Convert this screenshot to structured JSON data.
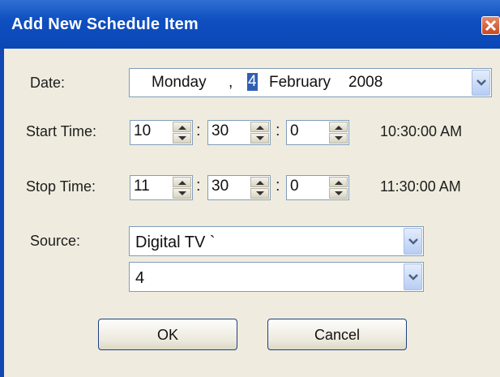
{
  "window": {
    "title": "Add New Schedule Item",
    "close_icon": "close-icon"
  },
  "date": {
    "label": "Date:",
    "day_name": "Monday",
    "separator": ",",
    "day": "4",
    "month": "February",
    "year": "2008"
  },
  "start_time": {
    "label": "Start Time:",
    "hour": "10",
    "minute": "30",
    "second": "0",
    "colon": ":",
    "preview": "10:30:00 AM"
  },
  "stop_time": {
    "label": "Stop Time:",
    "hour": "11",
    "minute": "30",
    "second": "0",
    "colon": ":",
    "preview": "11:30:00 AM"
  },
  "source": {
    "label": "Source:",
    "type_value": "Digital TV `",
    "channel_value": "4"
  },
  "buttons": {
    "ok": "OK",
    "cancel": "Cancel"
  },
  "colors": {
    "title_bar": "#0a47b6",
    "dialog_bg": "#efecdf",
    "close": "#c64922",
    "selection": "#2f5fb3"
  }
}
